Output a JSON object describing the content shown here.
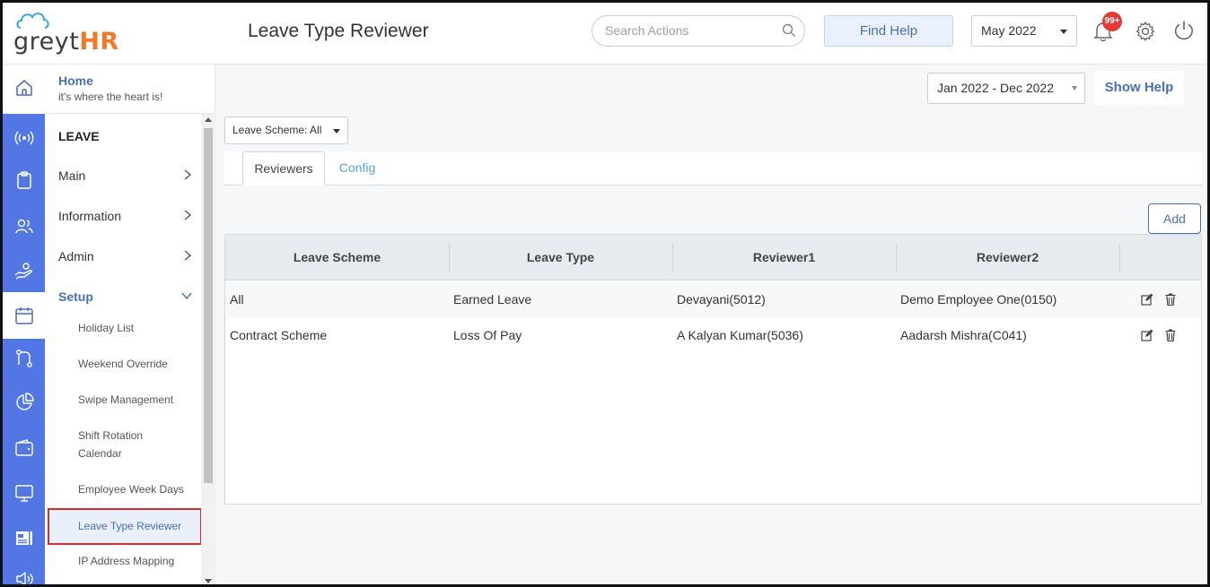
{
  "app": {
    "logo_text_left": "greyt",
    "logo_text_right": "HR",
    "page_title": "Leave Type Reviewer"
  },
  "header": {
    "search_placeholder": "Search Actions",
    "find_help_label": "Find Help",
    "month_value": "May 2022",
    "notification_badge": "99+"
  },
  "nav": {
    "home_title": "Home",
    "home_subtitle": "it's where the heart is!",
    "section_title": "LEAVE",
    "items": [
      {
        "label": "Main"
      },
      {
        "label": "Information"
      },
      {
        "label": "Admin"
      },
      {
        "label": "Setup"
      }
    ],
    "setup_items": [
      {
        "label": "Holiday List"
      },
      {
        "label": "Weekend Override"
      },
      {
        "label": "Swipe Management"
      },
      {
        "label": "Shift Rotation Calendar"
      },
      {
        "label": "Employee Week Days"
      },
      {
        "label": "Leave Type Reviewer"
      },
      {
        "label": "IP Address Mapping"
      }
    ]
  },
  "main": {
    "date_range": "Jan 2022 - Dec 2022",
    "show_help_label": "Show Help",
    "scheme_filter": "Leave Scheme: All",
    "tabs": [
      {
        "label": "Reviewers"
      },
      {
        "label": "Config"
      }
    ],
    "add_label": "Add",
    "table": {
      "columns": [
        "Leave Scheme",
        "Leave Type",
        "Reviewer1",
        "Reviewer2"
      ],
      "rows": [
        [
          "All",
          "Earned Leave",
          "Devayani(5012)",
          "Demo Employee One(0150)"
        ],
        [
          "Contract Scheme",
          "Loss Of Pay",
          "A Kalyan Kumar(5036)",
          "Aadarsh Mishra(C041)"
        ]
      ]
    }
  },
  "colors": {
    "accent": "#4a6fb5",
    "rail": "#5277e5",
    "badge": "#e53935",
    "logo_orange": "#f07a2a",
    "active_outline": "#d32f2f"
  }
}
